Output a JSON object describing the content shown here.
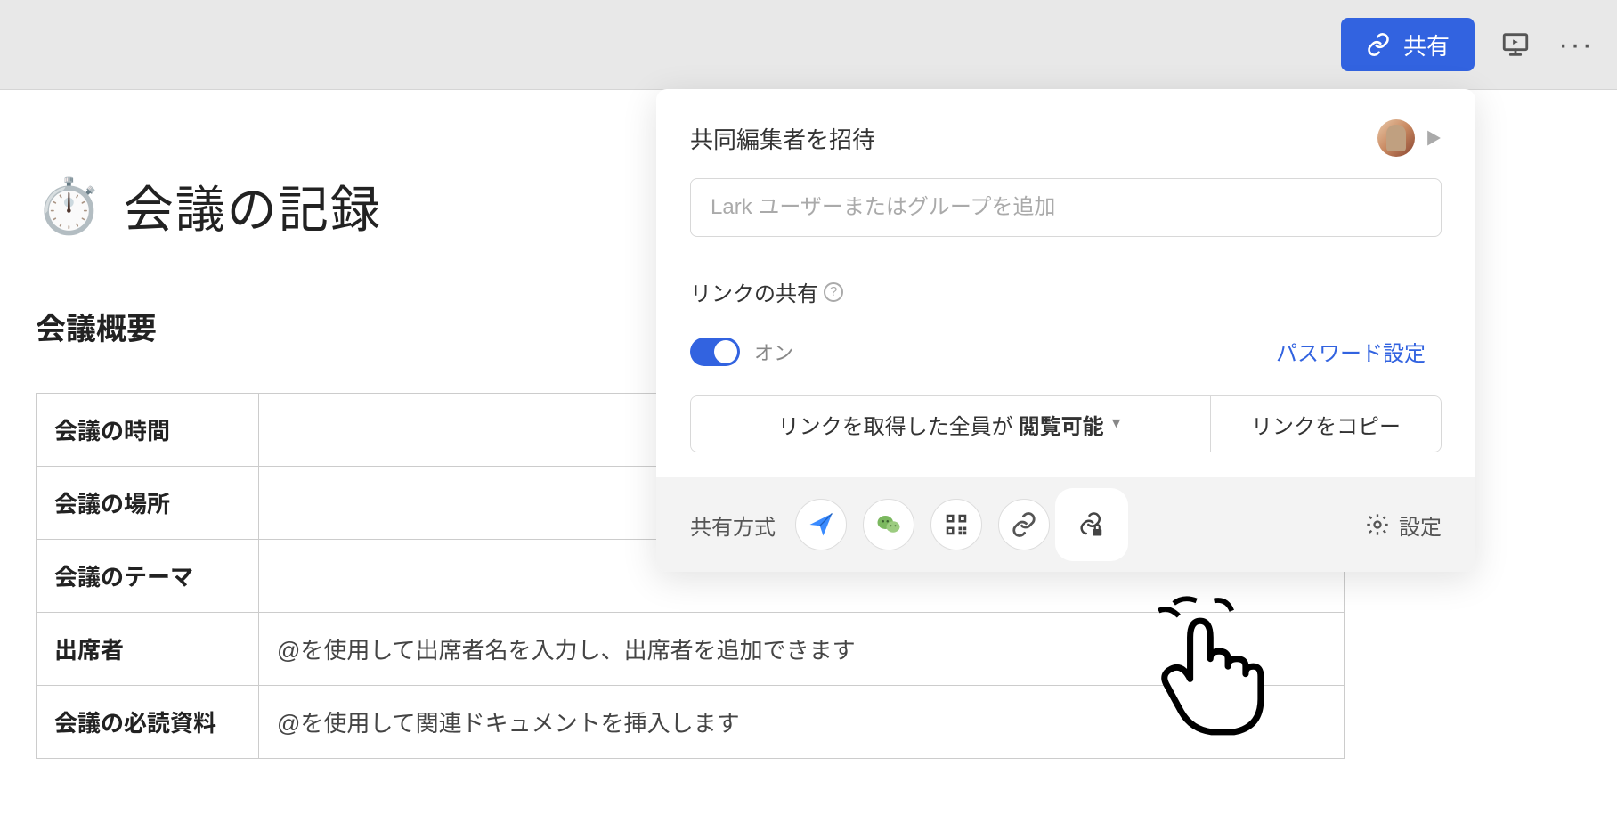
{
  "topbar": {
    "share_label": "共有"
  },
  "doc": {
    "emoji": "⏱️",
    "title": "会議の記録",
    "section_heading": "会議概要",
    "rows": [
      {
        "label": "会議の時間",
        "value": ""
      },
      {
        "label": "会議の場所",
        "value": ""
      },
      {
        "label": "会議のテーマ",
        "value": ""
      },
      {
        "label": "出席者",
        "value": "@を使用して出席者名を入力し、出席者を追加できます"
      },
      {
        "label": "会議の必読資料",
        "value": "@を使用して関連ドキュメントを挿入します"
      }
    ]
  },
  "share_popover": {
    "invite_title": "共同編集者を招待",
    "invite_placeholder": "Lark ユーザーまたはグループを追加",
    "link_title": "リンクの共有",
    "toggle_state": "オン",
    "password_label": "パスワード設定",
    "perm_prefix": "リンクを取得した全員が",
    "perm_value": "閲覧可能",
    "copy_label": "リンクをコピー",
    "methods_label": "共有方式",
    "settings_label": "設定"
  }
}
